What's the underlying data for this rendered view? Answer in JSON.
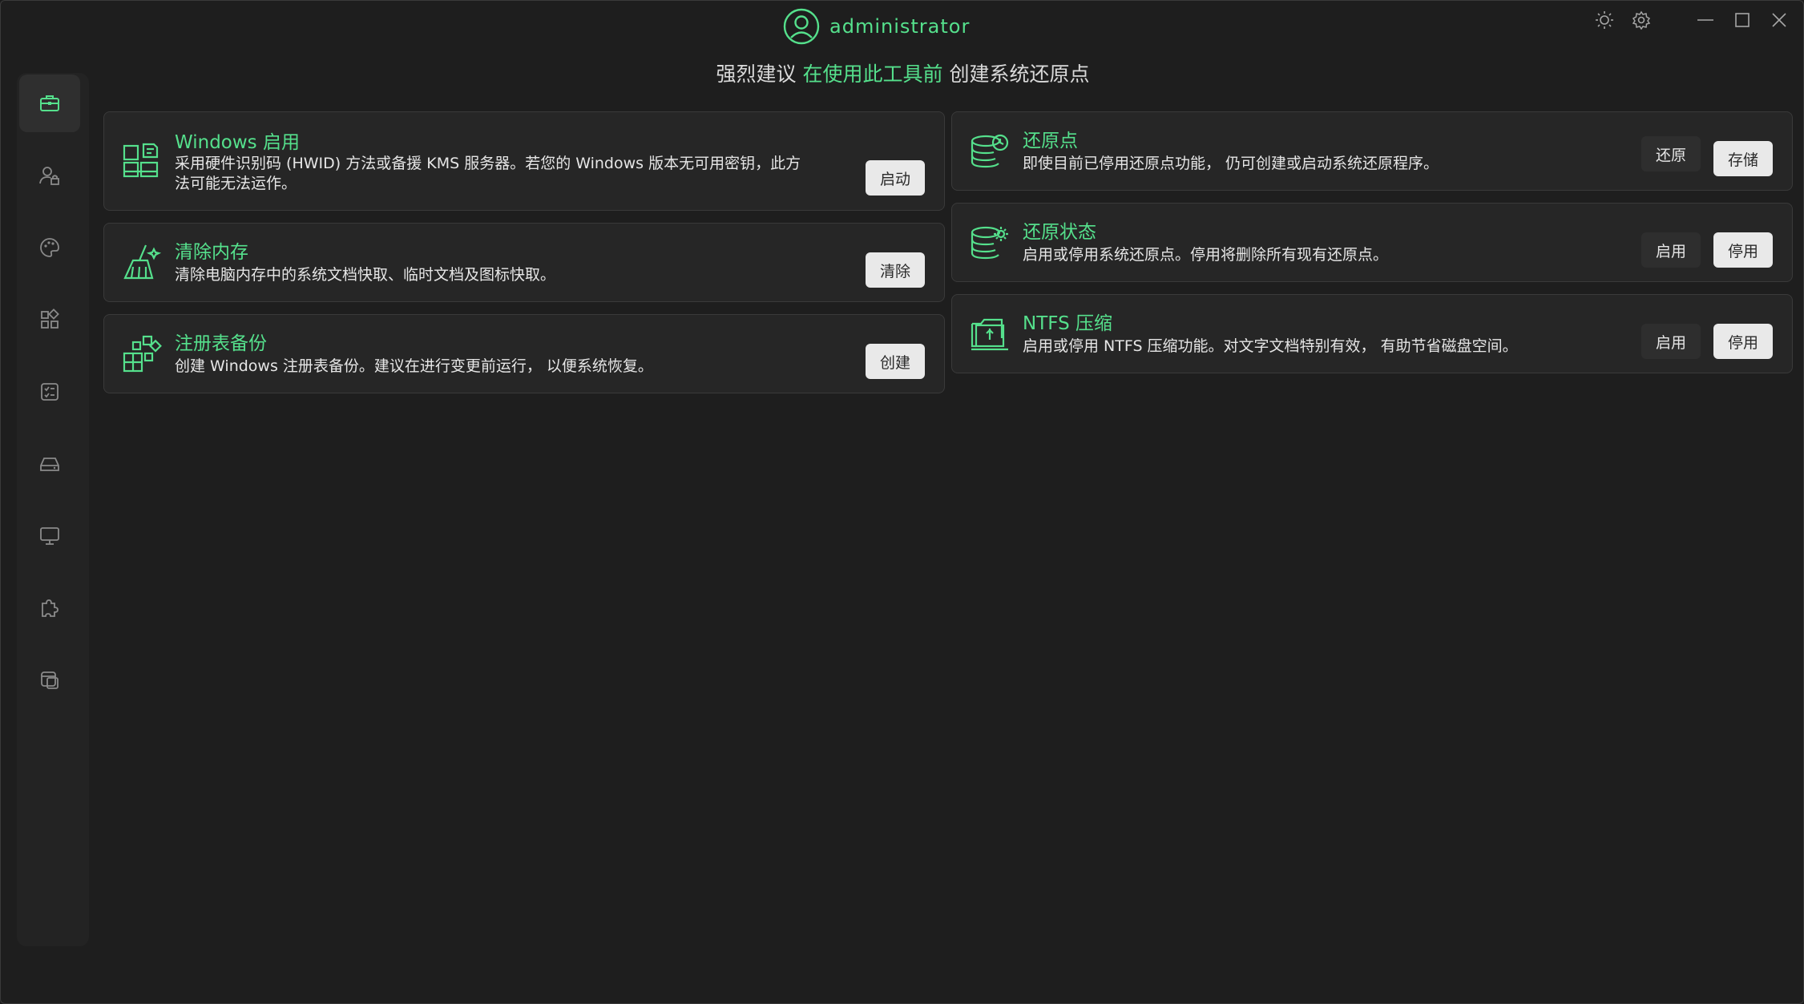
{
  "titlebar": {
    "username": "administrator",
    "icons": [
      "theme-sun-icon",
      "settings-gear-icon",
      "minimize-icon",
      "maximize-icon",
      "close-icon"
    ]
  },
  "advice": {
    "prefix": "强烈建议",
    "highlight": "在使用此工具前",
    "suffix": "创建系统还原点"
  },
  "sidebar": {
    "items": [
      {
        "icon": "toolbox-icon",
        "active": true
      },
      {
        "icon": "user-lock-icon",
        "active": false
      },
      {
        "icon": "palette-icon",
        "active": false
      },
      {
        "icon": "apps-grid-icon",
        "active": false
      },
      {
        "icon": "checklist-icon",
        "active": false
      },
      {
        "icon": "drive-icon",
        "active": false
      },
      {
        "icon": "monitor-icon",
        "active": false
      },
      {
        "icon": "puzzle-gear-icon",
        "active": false
      },
      {
        "icon": "window-copy-icon",
        "active": false
      }
    ]
  },
  "cards": {
    "windows_activation": {
      "title": "Windows 启用",
      "desc_line1": "采用硬件识别码 (HWID) 方法或备援 KMS 服务器。若您的 Windows 版本无可用密钥，此方",
      "desc_line2": "法可能无法运作。",
      "button": "启动"
    },
    "clear_memory": {
      "title": "清除内存",
      "desc": "清除电脑内存中的系统文档快取、临时文档及图标快取。",
      "button": "清除"
    },
    "registry_backup": {
      "title": "注册表备份",
      "desc": "创建 Windows 注册表备份。建议在进行变更前运行， 以便系统恢复。",
      "button": "创建"
    },
    "restore_point": {
      "title": "还原点",
      "desc": "即使目前已停用还原点功能， 仍可创建或启动系统还原程序。",
      "button_restore": "还原",
      "button_save": "存储"
    },
    "restore_state": {
      "title": "还原状态",
      "desc": "启用或停用系统还原点。停用将删除所有现有还原点。",
      "button_enable": "启用",
      "button_disable": "停用"
    },
    "ntfs_compression": {
      "title": "NTFS 压缩",
      "desc": "启用或停用 NTFS 压缩功能。对文字文档特别有效， 有助节省磁盘空间。",
      "button_enable": "启用",
      "button_disable": "停用"
    }
  },
  "colors": {
    "accent": "#55e08c",
    "background": "#1e1e1e",
    "card": "#262626"
  }
}
